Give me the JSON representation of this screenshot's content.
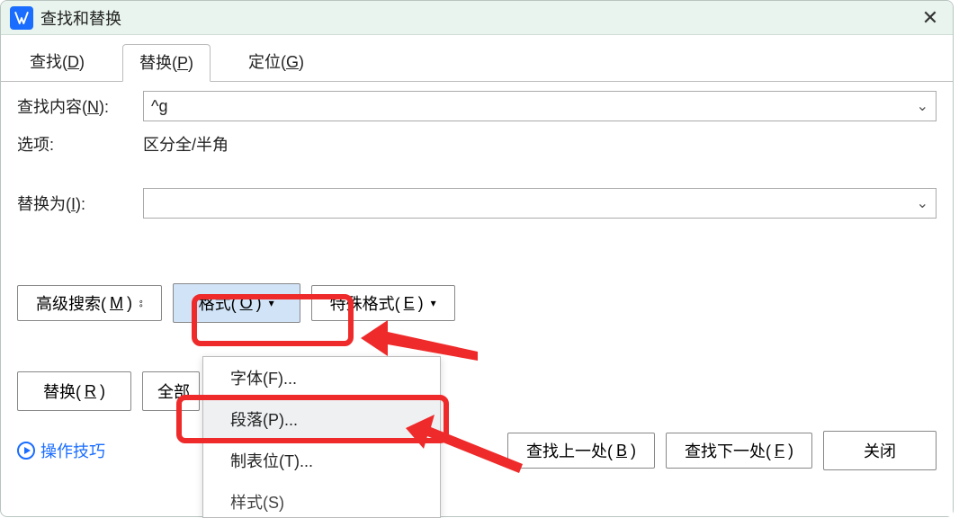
{
  "titlebar": {
    "title": "查找和替换"
  },
  "tabs": {
    "find": {
      "text": "查找(",
      "accel": "D",
      "after": ")"
    },
    "replace": {
      "text": "替换(",
      "accel": "P",
      "after": ")"
    },
    "goto": {
      "text": "定位(",
      "accel": "G",
      "after": ")"
    }
  },
  "find": {
    "label_pre": "查找内容(",
    "label_accel": "N",
    "label_post": "):",
    "value": "^g"
  },
  "options": {
    "label": "选项:",
    "value": "区分全/半角"
  },
  "replace": {
    "label_pre": "替换为(",
    "label_accel": "I",
    "label_post": "):",
    "value": ""
  },
  "buttons": {
    "advanced": {
      "text": "高级搜索(",
      "accel": "M",
      "after": ")"
    },
    "format": {
      "text": "格式(",
      "accel": "O",
      "after": ")"
    },
    "special": {
      "text": "特殊格式(",
      "accel": "E",
      "after": ")"
    },
    "replace_one": {
      "text": "替换(",
      "accel": "R",
      "after": ")"
    },
    "replace_all": {
      "text": "全部"
    }
  },
  "format_menu": {
    "font": "字体(F)...",
    "paragraph": "段落(P)...",
    "tabs": "制表位(T)...",
    "style": "样式(S)"
  },
  "footer": {
    "tips": "操作技巧",
    "find_prev": {
      "text": "查找上一处(",
      "accel": "B",
      "after": ")"
    },
    "find_next": {
      "text": "查找下一处(",
      "accel": "F",
      "after": ")"
    },
    "close": "关闭"
  }
}
